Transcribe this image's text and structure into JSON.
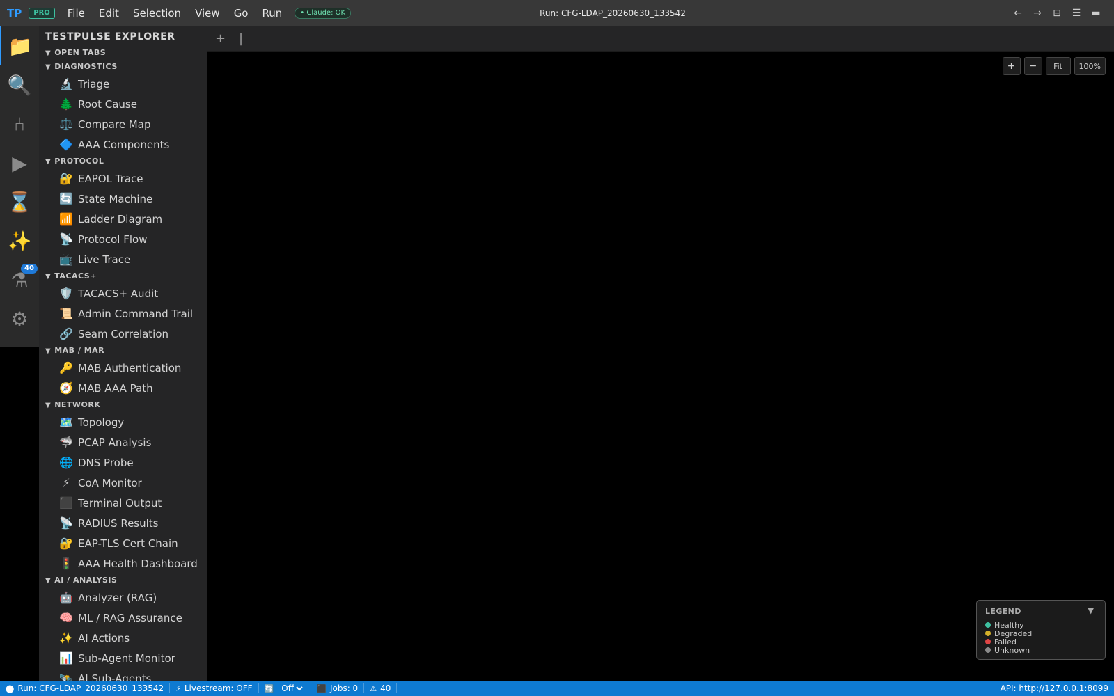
{
  "app": {
    "logo": "TP",
    "pro_badge": "PRO",
    "menu": [
      "File",
      "Edit",
      "Selection",
      "View",
      "Go",
      "Run"
    ],
    "claude_status": "• Claude: OK",
    "run_title": "Run: CFG-LDAP_20260630_133542",
    "window_controls": [
      "←",
      "→",
      "⊟",
      "☰",
      "▬"
    ]
  },
  "activity_bar": {
    "items": [
      {
        "name": "explorer",
        "icon": "📁"
      },
      {
        "name": "search",
        "icon": "🔍"
      },
      {
        "name": "source-control",
        "icon": "⑃"
      },
      {
        "name": "run",
        "icon": "▶"
      },
      {
        "name": "history",
        "icon": "⌛"
      },
      {
        "name": "ai",
        "icon": "✨"
      },
      {
        "name": "tests",
        "icon": "⚗",
        "badge": "40"
      },
      {
        "name": "settings",
        "icon": "⚙"
      }
    ]
  },
  "sidebar": {
    "title": "TESTPULSE EXPLORER",
    "sections": [
      {
        "title": "OPEN TABS",
        "items": []
      },
      {
        "title": "DIAGNOSTICS",
        "items": [
          {
            "icon": "🔬",
            "label": "Triage"
          },
          {
            "icon": "🌲",
            "label": "Root Cause"
          },
          {
            "icon": "⚖️",
            "label": "Compare Map"
          },
          {
            "icon": "🔷",
            "label": "AAA Components"
          }
        ]
      },
      {
        "title": "PROTOCOL",
        "items": [
          {
            "icon": "🔐",
            "label": "EAPOL Trace"
          },
          {
            "icon": "🔄",
            "label": "State Machine"
          },
          {
            "icon": "📶",
            "label": "Ladder Diagram"
          },
          {
            "icon": "📡",
            "label": "Protocol Flow"
          },
          {
            "icon": "📺",
            "label": "Live Trace"
          }
        ]
      },
      {
        "title": "TACACS+",
        "items": [
          {
            "icon": "🛡️",
            "label": "TACACS+ Audit"
          },
          {
            "icon": "📜",
            "label": "Admin Command Trail"
          },
          {
            "icon": "🔗",
            "label": "Seam Correlation"
          }
        ]
      },
      {
        "title": "MAB / MAR",
        "items": [
          {
            "icon": "🔑",
            "label": "MAB Authentication"
          },
          {
            "icon": "🧭",
            "label": "MAB AAA Path"
          }
        ]
      },
      {
        "title": "NETWORK",
        "items": [
          {
            "icon": "🗺️",
            "label": "Topology"
          },
          {
            "icon": "🦈",
            "label": "PCAP Analysis"
          },
          {
            "icon": "🌐",
            "label": "DNS Probe"
          },
          {
            "icon": "⚡",
            "label": "CoA Monitor"
          },
          {
            "icon": "⬛",
            "label": "Terminal Output"
          },
          {
            "icon": "📡",
            "label": "RADIUS Results"
          },
          {
            "icon": "🔐",
            "label": "EAP-TLS Cert Chain"
          },
          {
            "icon": "🚦",
            "label": "AAA Health Dashboard"
          }
        ]
      },
      {
        "title": "AI / ANALYSIS",
        "items": [
          {
            "icon": "🤖",
            "label": "Analyzer (RAG)"
          },
          {
            "icon": "🧠",
            "label": "ML / RAG Assurance"
          },
          {
            "icon": "✨",
            "label": "AI Actions"
          },
          {
            "icon": "📊",
            "label": "Sub-Agent Monitor"
          },
          {
            "icon": "🛰️",
            "label": "AI Sub-Agents"
          }
        ]
      }
    ]
  },
  "tabbar": {
    "add_label": "+",
    "separator": "|"
  },
  "canvas": {
    "zoom_controls": {
      "zoom_in": "+",
      "zoom_out": "−",
      "fit": "Fit",
      "reset": "100%"
    },
    "legend": {
      "title": "LEGEND",
      "toggle": "▼",
      "items": [
        {
          "label": "Healthy",
          "color": "#3ec0a0"
        },
        {
          "label": "Degraded",
          "color": "#d4b02a"
        },
        {
          "label": "Failed",
          "color": "#e04545"
        },
        {
          "label": "Unknown",
          "color": "#8a8a8a"
        }
      ]
    }
  },
  "statusbar": {
    "run": "Run: CFG-LDAP_20260630_133542",
    "livestream": "Livestream: OFF",
    "refresh_value": "Off",
    "refresh_options": [
      "Off"
    ],
    "jobs": "Jobs: 0",
    "warnings": "40",
    "api": "API: http://127.0.0.1:8099"
  },
  "colors": {
    "accent": "#2f9bff",
    "statusbar": "#0e7ad1",
    "sidebar": "#252526"
  }
}
